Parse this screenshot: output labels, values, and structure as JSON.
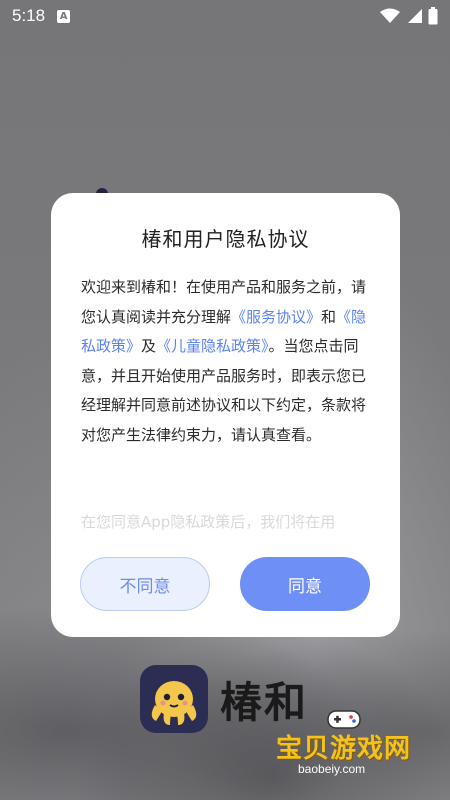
{
  "status_bar": {
    "time": "5:18",
    "notification_icon": "a-app-icon",
    "wifi_icon": "wifi-icon",
    "signal_icon": "signal-icon",
    "battery_icon": "battery-icon"
  },
  "dialog": {
    "title": "椿和用户隐私协议",
    "body": {
      "p1": "欢迎来到椿和！在使用产品和服务之前，请您认真阅读并充分理解",
      "link_service": "《服务协议》",
      "and": "和",
      "link_privacy": "《隐私政策》",
      "and2": "及",
      "link_children": "《儿童隐私政策》",
      "p2": "。当您点击同意，并且开始使用产品服务时，即表示您已经理解并同意前述协议和以下约定，条款将对您产生法律约束力，请认真查看。"
    },
    "fade_text": "在您同意App隐私政策后，我们将在用",
    "disagree_label": "不同意",
    "agree_label": "同意"
  },
  "app": {
    "name": "椿和",
    "logo_icon": "octopus-mascot-icon"
  },
  "watermark": {
    "text": "宝贝游戏网",
    "url": "baobeiy.com"
  },
  "colors": {
    "link": "#5b83f2",
    "agree_bg": "#6e8ff5",
    "disagree_bg": "#eaf0fe",
    "mascot": "#f4c64b"
  }
}
